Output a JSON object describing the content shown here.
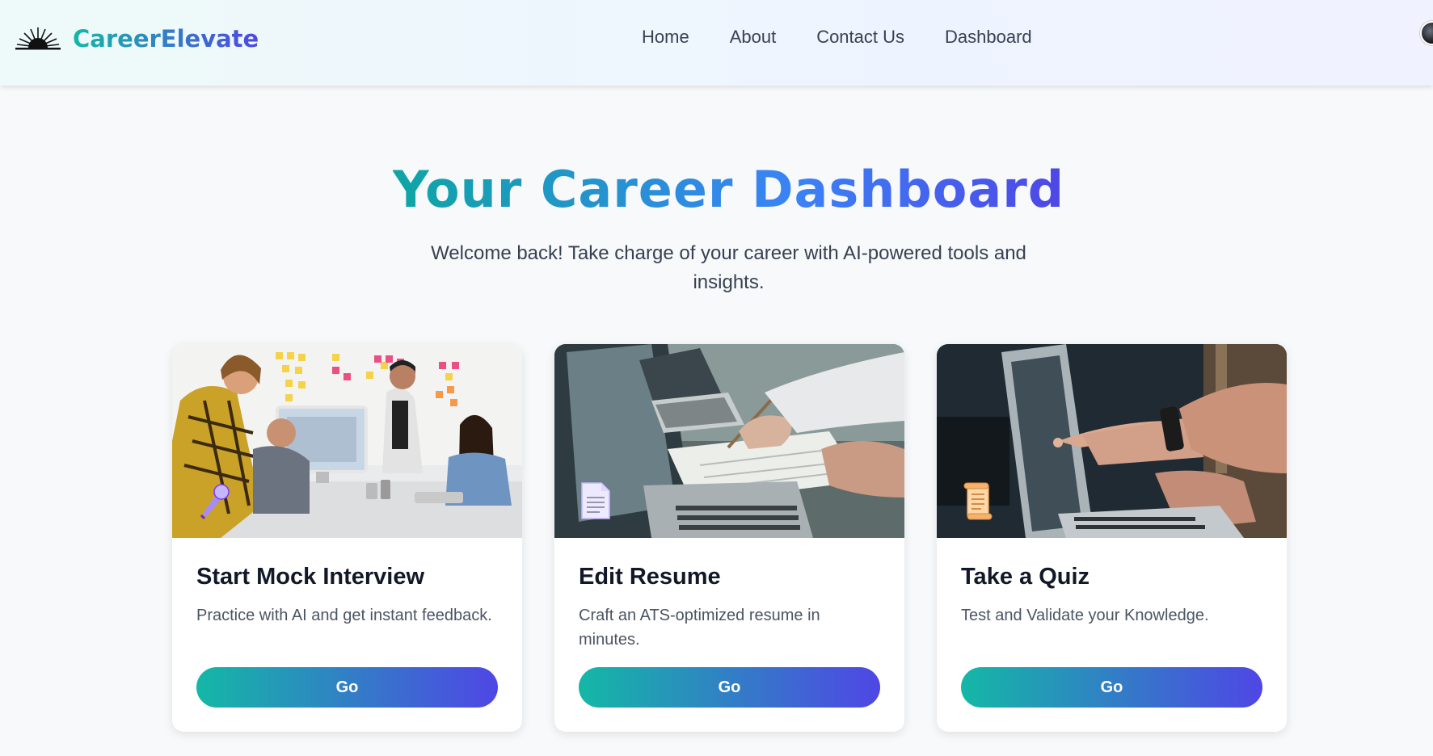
{
  "brand": {
    "name": "CareerElevate",
    "logo_icon": "sunrise-icon"
  },
  "nav": {
    "links": [
      {
        "label": "Home"
      },
      {
        "label": "About"
      },
      {
        "label": "Contact Us"
      },
      {
        "label": "Dashboard"
      }
    ]
  },
  "hero": {
    "title": "Your Career Dashboard",
    "subtitle": "Welcome back! Take charge of your career with AI-powered tools and insights."
  },
  "cards": [
    {
      "title": "Start Mock Interview",
      "description": "Practice with AI and get instant feedback.",
      "button": "Go",
      "icon": "microphone-icon",
      "image": "team-meeting-photo"
    },
    {
      "title": "Edit Resume",
      "description": "Craft an ATS-optimized resume in minutes.",
      "button": "Go",
      "icon": "document-icon",
      "image": "laptop-writing-photo"
    },
    {
      "title": "Take a Quiz",
      "description": "Test and Validate your Knowledge.",
      "button": "Go",
      "icon": "scroll-icon",
      "image": "laptop-pointing-photo"
    }
  ],
  "colors": {
    "gradient_start": "#14b8a6",
    "gradient_end": "#4f46e5",
    "background": "#f7f9fb"
  }
}
